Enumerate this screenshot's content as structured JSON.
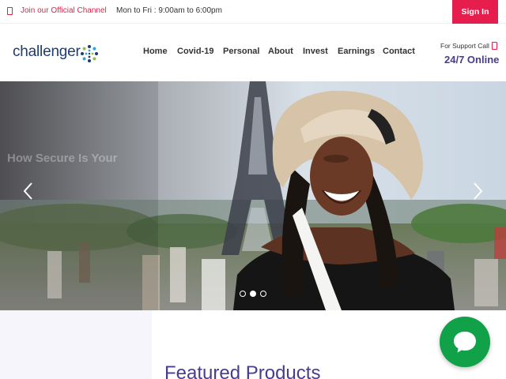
{
  "topbar": {
    "channel_icon": "phone-icon",
    "channel_label": "Join our Official Channel",
    "hours": "Mon to Fri : 9:00am to 6:00pm",
    "signin_label": "Sign In"
  },
  "header": {
    "logo_text": "challenger",
    "nav": [
      {
        "label": "Home",
        "active": true
      },
      {
        "label": "Covid-19",
        "active": true
      },
      {
        "label": "Personal",
        "active": false
      },
      {
        "label": "About",
        "active": false
      },
      {
        "label": "Invest",
        "active": false
      },
      {
        "label": "Earnings",
        "active": false
      },
      {
        "label": "Contact",
        "active": false
      }
    ],
    "support_label": "For Support Call",
    "support_value": "24/7 Online"
  },
  "hero": {
    "heading": "How Secure Is Your",
    "prev_icon": "chevron-left-icon",
    "next_icon": "chevron-right-icon",
    "slide_count": 3,
    "active_slide": 2
  },
  "section": {
    "title": "Featured Products"
  },
  "chat": {
    "icon": "chat-bubble-icon"
  },
  "colors": {
    "accent": "#e61e4d",
    "brand_purple": "#4a3c8c",
    "logo_blue": "#1c3b77",
    "chat_green": "#11a249"
  }
}
